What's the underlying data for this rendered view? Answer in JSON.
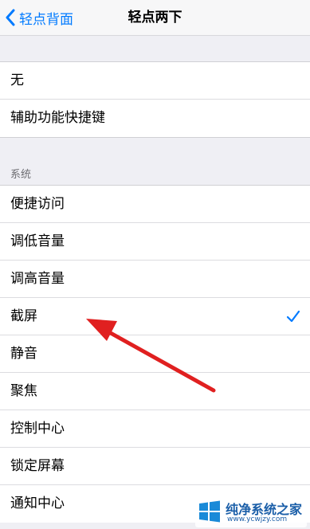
{
  "nav": {
    "back_label": "轻点背面",
    "title": "轻点两下"
  },
  "top_group": [
    {
      "label": "无"
    },
    {
      "label": "辅助功能快捷键"
    }
  ],
  "system_section": {
    "header": "系统",
    "items": [
      {
        "label": "便捷访问"
      },
      {
        "label": "调低音量"
      },
      {
        "label": "调高音量"
      },
      {
        "label": "截屏",
        "selected": true
      },
      {
        "label": "静音"
      },
      {
        "label": "聚焦"
      },
      {
        "label": "控制中心"
      },
      {
        "label": "锁定屏幕"
      },
      {
        "label": "通知中心"
      }
    ]
  },
  "colors": {
    "accent": "#007aff",
    "annotation_arrow": "#e02020"
  },
  "watermark": {
    "name": "纯净系统之家",
    "url": "www.ycwjzy.com"
  }
}
